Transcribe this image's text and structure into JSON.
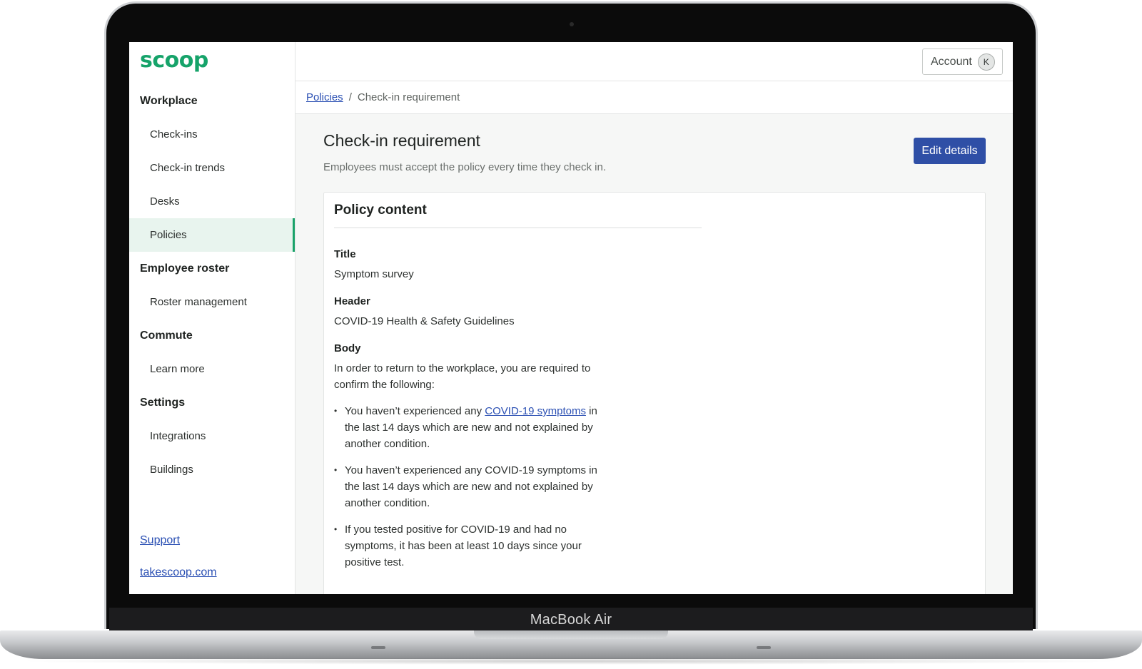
{
  "device": {
    "label": "MacBook Air"
  },
  "brand": {
    "logo_text": "scoop",
    "accent_color": "#16a36a",
    "primary_button_color": "#2f4fa6",
    "link_color": "#2a4fb3"
  },
  "sidebar": {
    "sections": [
      {
        "label": "Workplace",
        "items": [
          {
            "label": "Check-ins",
            "active": false
          },
          {
            "label": "Check-in trends",
            "active": false
          },
          {
            "label": "Desks",
            "active": false
          },
          {
            "label": "Policies",
            "active": true
          }
        ]
      },
      {
        "label": "Employee roster",
        "items": [
          {
            "label": "Roster management",
            "active": false
          }
        ]
      },
      {
        "label": "Commute",
        "items": [
          {
            "label": "Learn more",
            "active": false
          }
        ]
      },
      {
        "label": "Settings",
        "items": [
          {
            "label": "Integrations",
            "active": false
          },
          {
            "label": "Buildings",
            "active": false
          }
        ]
      }
    ],
    "footer_links": {
      "support": "Support",
      "website": "takescoop.com"
    }
  },
  "topbar": {
    "account_label": "Account",
    "avatar_initial": "K"
  },
  "breadcrumb": {
    "parent": "Policies",
    "separator": "/",
    "current": "Check-in requirement"
  },
  "page": {
    "title": "Check-in requirement",
    "description": "Employees must accept the policy every time they check in.",
    "edit_button": "Edit details"
  },
  "policy_card": {
    "heading": "Policy content",
    "title_label": "Title",
    "title_value": "Symptom survey",
    "header_label": "Header",
    "header_value": "COVID-19 Health & Safety Guidelines",
    "body_label": "Body",
    "body_intro": "In order to return to the workplace, you are required to confirm the following:",
    "bullet_1_pre": "You haven’t experienced any ",
    "bullet_1_link": "COVID-19 symptoms",
    "bullet_1_post": " in the last 14 days which are new and not explained by another condition.",
    "bullet_2": "You haven’t experienced any COVID-19 symptoms in the last 14 days which are new and not explained by another condition.",
    "bullet_3": "If you tested positive for COVID-19 and had no symptoms, it has been at least 10 days since your positive test."
  }
}
